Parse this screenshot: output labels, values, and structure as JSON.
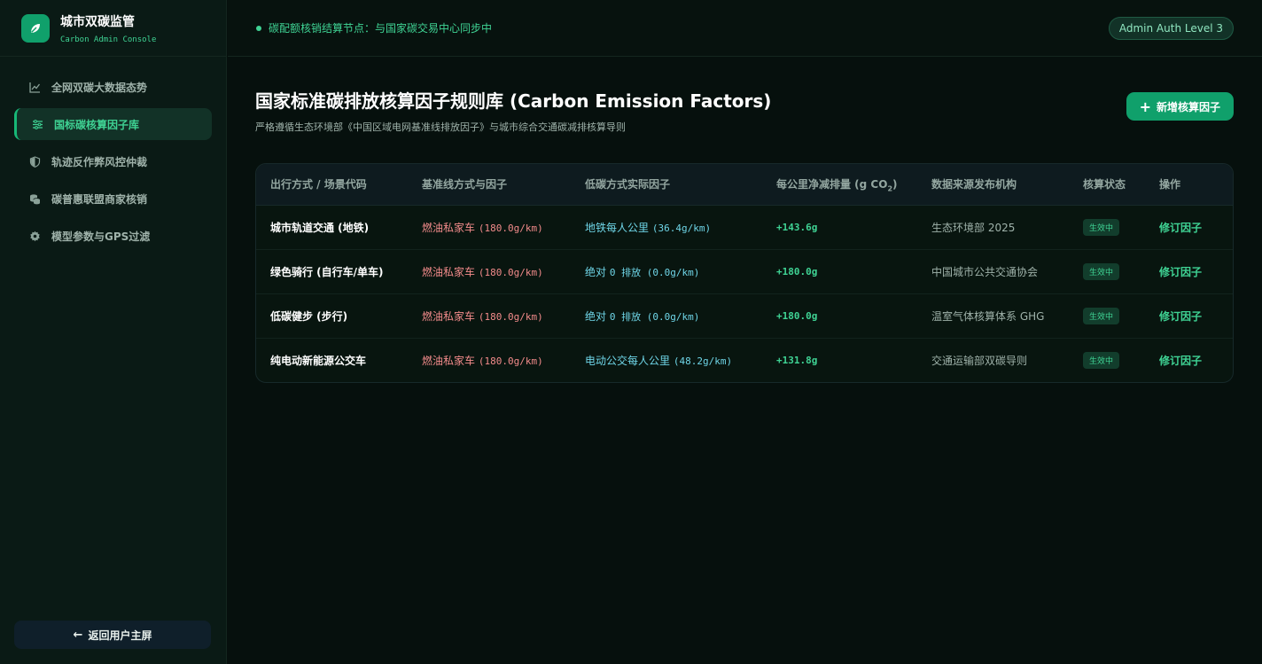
{
  "brand": {
    "title": "城市双碳监管",
    "subtitle": "Carbon Admin Console",
    "logo_icon": "leaf-icon",
    "logo_color": "#10a06b"
  },
  "sidebar": {
    "items": [
      {
        "label": "全网双碳大数据态势",
        "icon": "chart-line-icon",
        "active": false
      },
      {
        "label": "国标碳核算因子库",
        "icon": "sliders-icon",
        "active": true
      },
      {
        "label": "轨迹反作弊风控仲裁",
        "icon": "shield-icon",
        "active": false
      },
      {
        "label": "碳普惠联盟商家核销",
        "icon": "coins-icon",
        "active": false
      },
      {
        "label": "模型参数与GPS过滤",
        "icon": "gear-icon",
        "active": false
      }
    ],
    "back_label": "返回用户主屏"
  },
  "topbar": {
    "sync_text": "碳配额核销结算节点：与国家碳交易中心同步中",
    "auth_badge": "Admin Auth Level 3"
  },
  "page": {
    "title": "国家标准碳排放核算因子规则库 (Carbon Emission Factors)",
    "subtitle": "严格遵循生态环境部《中国区域电网基准线排放因子》与城市综合交通碳减排核算导则",
    "add_button": "新增核算因子"
  },
  "table": {
    "headers": {
      "mode": "出行方式 / 场景代码",
      "baseline": "基准线方式与因子",
      "lowcarbon": "低碳方式实际因子",
      "net_pre": "每公里净减排量 (g CO",
      "net_sub": "2",
      "net_post": ")",
      "source": "数据来源发布机构",
      "status": "核算状态",
      "action": "操作"
    },
    "rows": [
      {
        "mode": "城市轨道交通 (地铁)",
        "base_name": "燃油私家车",
        "base_val": "(180.0g/km)",
        "low_name": "地铁每人公里",
        "low_val": "(36.4g/km)",
        "net": "+143.6g",
        "source": "生态环境部 2025",
        "status": "生效中",
        "action": "修订因子"
      },
      {
        "mode": "绿色骑行 (自行车/单车)",
        "base_name": "燃油私家车",
        "base_val": "(180.0g/km)",
        "low_name": "绝对",
        "low_val": "0 排放 (0.0g/km)",
        "net": "+180.0g",
        "source": "中国城市公共交通协会",
        "status": "生效中",
        "action": "修订因子"
      },
      {
        "mode": "低碳健步 (步行)",
        "base_name": "燃油私家车",
        "base_val": "(180.0g/km)",
        "low_name": "绝对",
        "low_val": "0 排放 (0.0g/km)",
        "net": "+180.0g",
        "source": "温室气体核算体系 GHG",
        "status": "生效中",
        "action": "修订因子"
      },
      {
        "mode": "纯电动新能源公交车",
        "base_name": "燃油私家车",
        "base_val": "(180.0g/km)",
        "low_name": "电动公交每人公里",
        "low_val": "(48.2g/km)",
        "net": "+131.8g",
        "source": "交通运输部双碳导则",
        "status": "生效中",
        "action": "修订因子"
      }
    ]
  }
}
